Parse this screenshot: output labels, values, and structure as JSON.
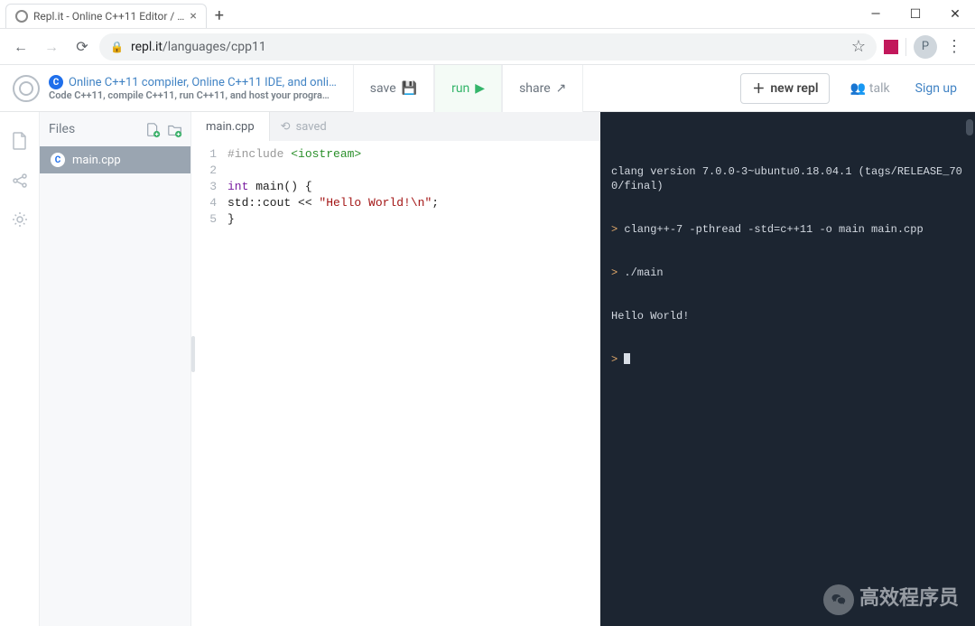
{
  "browser": {
    "tab_title": "Repl.it - Online C++11 Editor / …",
    "url_host": "repl.it",
    "url_path": "/languages/cpp11",
    "avatar_letter": "P"
  },
  "repl_header": {
    "title": "Online C++11 compiler, Online C++11 IDE, and onli…",
    "subtitle": "Code C++11, compile C++11, run C++11, and host your progra…",
    "save_label": "save",
    "run_label": "run",
    "share_label": "share",
    "new_repl_label": "new repl",
    "talk_label": "talk",
    "signup_label": "Sign up"
  },
  "files_panel": {
    "label": "Files",
    "items": [
      "main.cpp"
    ]
  },
  "editor": {
    "filename": "main.cpp",
    "saved_label": "saved",
    "code": {
      "lines": [
        1,
        2,
        3,
        4,
        5
      ],
      "l1_include": "#include",
      "l1_target": " <iostream>",
      "l3_kw": "int",
      "l3_rest": " main() {",
      "l4_indent": "  std::cout << ",
      "l4_str": "\"Hello World!\\n\"",
      "l4_semi": ";",
      "l5": "}"
    }
  },
  "terminal": {
    "lines": {
      "l1": "clang version 7.0.0-3~ubuntu0.18.04.1 (tags/RELEASE_700/final)",
      "l2p": "> ",
      "l2": "clang++-7 -pthread -std=c++11 -o main main.cpp",
      "l3p": "> ",
      "l3": "./main",
      "l4": "Hello World!",
      "l5p": "> "
    }
  },
  "watermark": "高效程序员"
}
